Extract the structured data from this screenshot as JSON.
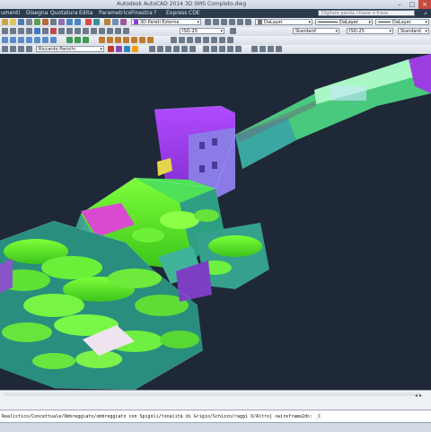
{
  "window": {
    "title": "Autodesk AutoCAD 2014  3D SMS Completo.dwg",
    "search_placeholder": "Digitare parola chiave o frase"
  },
  "menu": {
    "items": [
      "umenti",
      "Disegna",
      "Quotatura",
      "Edita",
      "Parametrico",
      "Finestra",
      "?",
      "Express",
      "CDE"
    ]
  },
  "toolbar": {
    "visual_style": "3D Pareti Esterne",
    "dim_style": "ISO-25",
    "layer_value": "DaLayer",
    "linetype_value": "DaLayer",
    "lineweight_value": "DaLayer",
    "text_style": "Standard",
    "dim_style_2": "ISO-25",
    "text_style_2": "Standard",
    "table_style": "Standard",
    "render_mode": "Riccardo Panichi",
    "accent_layer_color": "#8d3bd6"
  },
  "command": {
    "line": "Realistico/Concettuale/Ombreggiato/ombreggiato con Spigoli/tonalità di Grigio/Schizzo/raggi X/Altro] <wireframe2d>: _C"
  },
  "icons": [
    "minimize-icon",
    "maximize-icon",
    "close-icon",
    "search-icon",
    "layer-swatch-icon",
    "scroll-left-icon",
    "scroll-right-icon"
  ]
}
